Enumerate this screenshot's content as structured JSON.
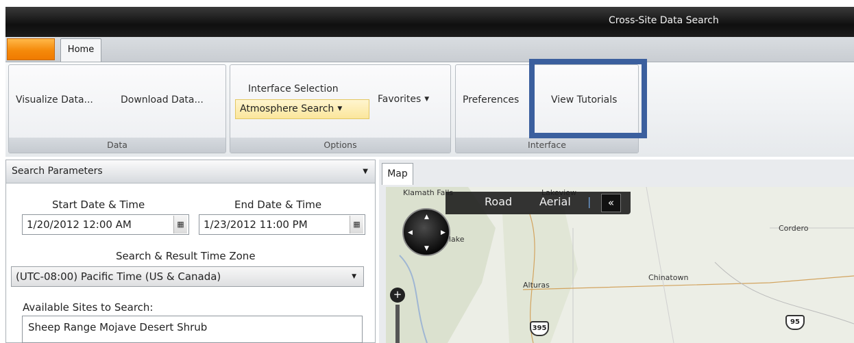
{
  "window": {
    "title": "Cross-Site Data Search"
  },
  "tabs": {
    "home": "Home"
  },
  "ribbon": {
    "data_group": {
      "label": "Data",
      "visualize": "Visualize Data...",
      "download": "Download Data..."
    },
    "options_group": {
      "label": "Options",
      "interface_selection_label": "Interface Selection",
      "interface_selection_value": "Atmosphere Search",
      "favorites": "Favorites"
    },
    "interface_group": {
      "label": "Interface",
      "preferences": "Preferences",
      "view_tutorials": "View Tutorials"
    }
  },
  "search_panel": {
    "header": "Search Parameters",
    "start_label": "Start Date & Time",
    "start_value": "1/20/2012 12:00 AM",
    "end_label": "End Date & Time",
    "end_value": "1/23/2012 11:00 PM",
    "tz_label": "Search & Result Time Zone",
    "tz_value": "(UTC-08:00) Pacific Time (US & Canada)",
    "sites_label": "Available Sites to Search:",
    "sites": [
      "Sheep Range Mojave Desert Shrub"
    ]
  },
  "map": {
    "tab": "Map",
    "modes": {
      "road": "Road",
      "aerial": "Aerial"
    },
    "places": {
      "lakeview": "Lakeview",
      "klamath": "Klamath Falls",
      "lake": "lake",
      "alturas": "Alturas",
      "chinatown": "Chinatown",
      "cordero": "Cordero"
    },
    "shields": {
      "us395": "395",
      "us95": "95"
    }
  },
  "colors": {
    "highlight": "#3b5f9e",
    "app_button": "#f58a0b",
    "combo_bg": "#fbe69b"
  }
}
